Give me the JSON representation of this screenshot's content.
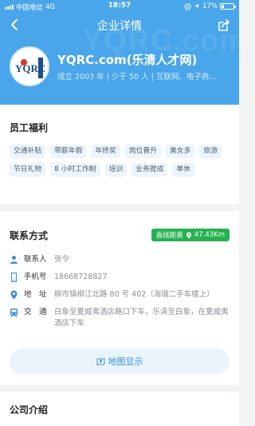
{
  "status_bar": {
    "carrier": "中国电信",
    "network": "4G",
    "time": "18:57",
    "battery": "17%"
  },
  "nav": {
    "title": "企业详情"
  },
  "hero": {
    "watermark": "YQRC.com",
    "logo_text": "YQRC",
    "name": "YQRC.com(乐清人才网)",
    "meta": "成立 2003 年 | 少于 50 人 | 互联网、电子商..."
  },
  "benefits": {
    "title": "员工福利",
    "tags": [
      "交通补贴",
      "带薪年假",
      "年终奖",
      "岗位晋升",
      "美女多",
      "旅游",
      "节日礼物",
      "8 小时工作制",
      "培训",
      "业务提成",
      "单休"
    ]
  },
  "contact": {
    "title": "联系方式",
    "distance_label": "直线距离",
    "distance_value": "47.43Km",
    "person_label": "联系人",
    "person_value": "张令",
    "phone_label": "手机号",
    "phone_value": "18668728827",
    "address_label": "地　址",
    "address_value": "柳市镇柳江北路 80 号 402（海瑞二手车楼上）",
    "transit_label": "交　通",
    "transit_value": "白象至夏威夷酒店路口下车，乐清至白象，在夏威夷酒店下车",
    "map_button": "地图显示"
  },
  "intro": {
    "title": "公司介绍"
  },
  "colors": {
    "header": "#4aa6ea",
    "accent": "#3b8fd8",
    "distance_badge": "#27b251",
    "tag_bg": "#ebf5fd"
  }
}
